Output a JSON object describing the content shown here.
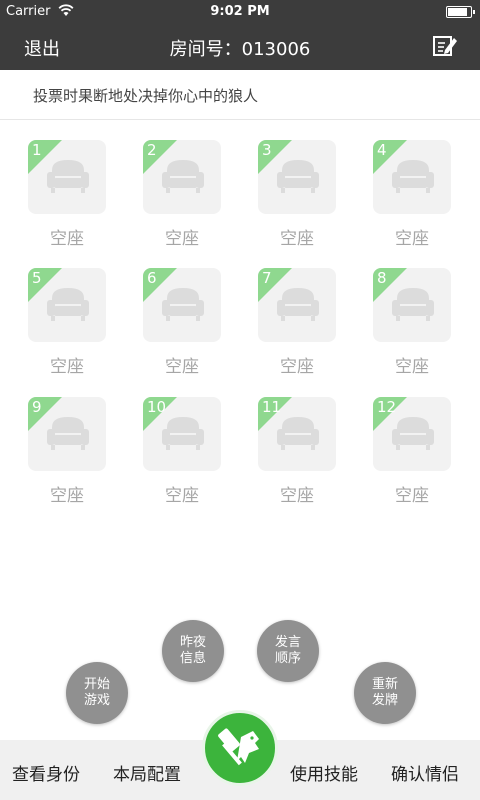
{
  "status_bar": {
    "carrier": "Carrier",
    "time": "9:02 PM",
    "battery_level": 0.9
  },
  "nav": {
    "back_label": "退出",
    "title": "房间号：013006",
    "edit_icon": "edit-icon"
  },
  "tip": "投票时果断地处决掉你心中的狼人",
  "seats": [
    {
      "number": "1",
      "label": "空座"
    },
    {
      "number": "2",
      "label": "空座"
    },
    {
      "number": "3",
      "label": "空座"
    },
    {
      "number": "4",
      "label": "空座"
    },
    {
      "number": "5",
      "label": "空座"
    },
    {
      "number": "6",
      "label": "空座"
    },
    {
      "number": "7",
      "label": "空座"
    },
    {
      "number": "8",
      "label": "空座"
    },
    {
      "number": "9",
      "label": "空座"
    },
    {
      "number": "10",
      "label": "空座"
    },
    {
      "number": "11",
      "label": "空座"
    },
    {
      "number": "12",
      "label": "空座"
    }
  ],
  "actions": {
    "start_game": [
      "开始",
      "游戏"
    ],
    "last_night": [
      "昨夜",
      "信息"
    ],
    "speak_order": [
      "发言",
      "顺序"
    ],
    "redeal": [
      "重新",
      "发牌"
    ]
  },
  "bottom_bar": {
    "view_identity": "查看身份",
    "game_config": "本局配置",
    "center_icon": "werewolf-hammer-icon",
    "use_skill": "使用技能",
    "confirm_couple": "确认情侣"
  },
  "colors": {
    "header_bg": "#3c3c3c",
    "seat_badge": "#8fd88f",
    "center_button": "#3cb43c",
    "fab_bg": "#909090"
  }
}
